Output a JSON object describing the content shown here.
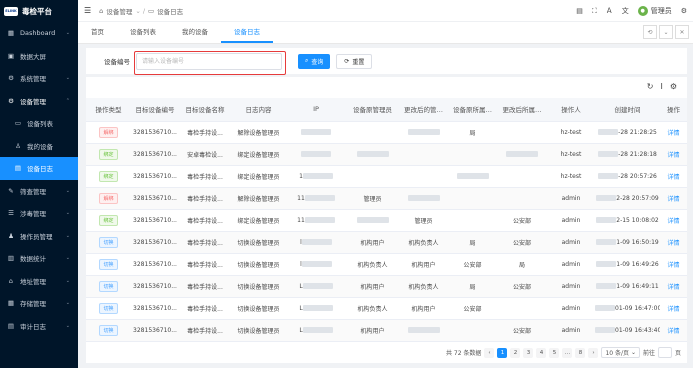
{
  "app": {
    "logo_badge": "ELINK",
    "title": "毒检平台"
  },
  "sidebar": {
    "items": [
      {
        "label": "Dashboard",
        "icon": "dashboard-icon",
        "glyph": "▦",
        "arrow": "⌄"
      },
      {
        "label": "数据大屏",
        "icon": "screen-icon",
        "glyph": "▣",
        "arrow": ""
      },
      {
        "label": "系统管理",
        "icon": "gear-icon",
        "glyph": "⚙",
        "arrow": "⌄"
      },
      {
        "label": "设备管理",
        "icon": "device-icon",
        "glyph": "⚙",
        "arrow": "⌃"
      },
      {
        "label": "设备列表",
        "icon": "list-icon",
        "glyph": "▭",
        "arrow": ""
      },
      {
        "label": "我的设备",
        "icon": "user-device-icon",
        "glyph": "♙",
        "arrow": ""
      },
      {
        "label": "设备日志",
        "icon": "log-icon",
        "glyph": "▤",
        "arrow": ""
      },
      {
        "label": "筛查管理",
        "icon": "filter-icon",
        "glyph": "✎",
        "arrow": "⌄"
      },
      {
        "label": "涉毒管理",
        "icon": "menu-icon",
        "glyph": "☰",
        "arrow": "⌄"
      },
      {
        "label": "操作员管理",
        "icon": "operator-icon",
        "glyph": "♟",
        "arrow": "⌄"
      },
      {
        "label": "数据统计",
        "icon": "stats-icon",
        "glyph": "▥",
        "arrow": "⌄"
      },
      {
        "label": "地址管理",
        "icon": "address-icon",
        "glyph": "⌂",
        "arrow": "⌄"
      },
      {
        "label": "存储管理",
        "icon": "storage-icon",
        "glyph": "▦",
        "arrow": "⌄"
      },
      {
        "label": "审计日志",
        "icon": "audit-icon",
        "glyph": "▤",
        "arrow": "⌄"
      }
    ]
  },
  "header": {
    "menu_glyph": "☰",
    "breadcrumb": [
      "设备管理",
      "设备日志"
    ],
    "username": "管理员",
    "icons": [
      {
        "name": "document-icon",
        "glyph": "▤"
      },
      {
        "name": "fullscreen-icon",
        "glyph": "⛶"
      },
      {
        "name": "font-size-icon",
        "glyph": "Ａ"
      },
      {
        "name": "translate-icon",
        "glyph": "文"
      }
    ],
    "settings_glyph": "⚙"
  },
  "tabs": [
    "首页",
    "设备列表",
    "我的设备",
    "设备日志"
  ],
  "search": {
    "label": "设备编号",
    "placeholder": "请输入设备编号",
    "value": "",
    "search_btn": "查询",
    "reset_btn": "重置"
  },
  "table": {
    "columns": [
      "操作类型",
      "目标设备编号",
      "目标设备名称",
      "日志内容",
      "IP",
      "设备原管理员",
      "更改后的管…",
      "设备原所属…",
      "更改后所属…",
      "操作人",
      "创建时间",
      "操作"
    ],
    "rows": [
      {
        "type": "解绑",
        "kind": "unbind",
        "code": "3281536710...",
        "name": "毒检手持设...",
        "content": "解除设备管理员",
        "ip": "",
        "old_admin": "",
        "new_admin": "",
        "old_org": "局",
        "new_org": "",
        "operator": "hz-test",
        "time": "-28 21:28:25",
        "action": "详情"
      },
      {
        "type": "绑定",
        "kind": "bind",
        "code": "3281536710...",
        "name": "安卓毒检设...",
        "content": "绑定设备管理员",
        "ip": "",
        "old_admin": "",
        "new_admin": "",
        "old_org": "",
        "new_org": "",
        "operator": "hz-test",
        "time": "-28 21:28:18",
        "action": "详情"
      },
      {
        "type": "绑定",
        "kind": "bind",
        "code": "3281536710...",
        "name": "毒检手持设...",
        "content": "绑定设备管理员",
        "ip": "1",
        "old_admin": "",
        "new_admin": "",
        "old_org": "",
        "new_org": "",
        "operator": "hz-test",
        "time": "-28 20:57:26",
        "action": "详情"
      },
      {
        "type": "解绑",
        "kind": "unbind",
        "code": "3281536710...",
        "name": "毒检手持设...",
        "content": "解除设备管理员",
        "ip": "11",
        "old_admin": "管理员",
        "new_admin": "",
        "old_org": "",
        "new_org": "",
        "operator": "admin",
        "time": "2-28 20:57:09",
        "action": "详情"
      },
      {
        "type": "绑定",
        "kind": "bind",
        "code": "3281536710...",
        "name": "毒检手持设...",
        "content": "绑定设备管理员",
        "ip": "11",
        "old_admin": "",
        "new_admin": "管理员",
        "old_org": "",
        "new_org": "公安部",
        "operator": "admin",
        "time": "2-15 10:08:02",
        "action": "详情"
      },
      {
        "type": "切换",
        "kind": "switch",
        "code": "3281536710...",
        "name": "毒检手持设...",
        "content": "切换设备管理员",
        "ip": "l",
        "old_admin": "机构用户",
        "new_admin": "机构负责人",
        "old_org": "局",
        "new_org": "公安部",
        "operator": "admin",
        "time": "1-09 16:50:19",
        "action": "详情"
      },
      {
        "type": "切换",
        "kind": "switch",
        "code": "3281536710...",
        "name": "毒检手持设...",
        "content": "切换设备管理员",
        "ip": "l",
        "old_admin": "机构负责人",
        "new_admin": "机构用户",
        "old_org": "公安部",
        "new_org": "局",
        "operator": "admin",
        "time": "1-09 16:49:26",
        "action": "详情"
      },
      {
        "type": "切换",
        "kind": "switch",
        "code": "3281536710...",
        "name": "毒检手持设...",
        "content": "切换设备管理员",
        "ip": "L",
        "old_admin": "机构用户",
        "new_admin": "机构负责人",
        "old_org": "局",
        "new_org": "公安部",
        "operator": "admin",
        "time": "1-09 16:49:11",
        "action": "详情"
      },
      {
        "type": "切换",
        "kind": "switch",
        "code": "3281536710...",
        "name": "毒检手持设...",
        "content": "切换设备管理员",
        "ip": "L",
        "old_admin": "机构负责人",
        "new_admin": "机构用户",
        "old_org": "公安部",
        "new_org": "",
        "operator": "admin",
        "time": "01-09 16:47:00",
        "action": "详情"
      },
      {
        "type": "切换",
        "kind": "switch",
        "code": "3281536710...",
        "name": "毒检手持设...",
        "content": "切换设备管理员",
        "ip": "L",
        "old_admin": "机构用户",
        "new_admin": "",
        "old_org": "",
        "new_org": "公安部",
        "operator": "admin",
        "time": "01-09 16:43:40",
        "action": "详情"
      }
    ]
  },
  "pagination": {
    "total": "共 72 条数据",
    "pages": [
      "1",
      "2",
      "3",
      "4",
      "5",
      "…",
      "8"
    ],
    "page_size": "10 条/页",
    "goto_label": "前往",
    "page_suffix": "页",
    "prev": "‹",
    "next": "›"
  },
  "colors": {
    "accent": "#1890ff",
    "sidebar": "#001529",
    "highlight": "#e63b3b"
  }
}
